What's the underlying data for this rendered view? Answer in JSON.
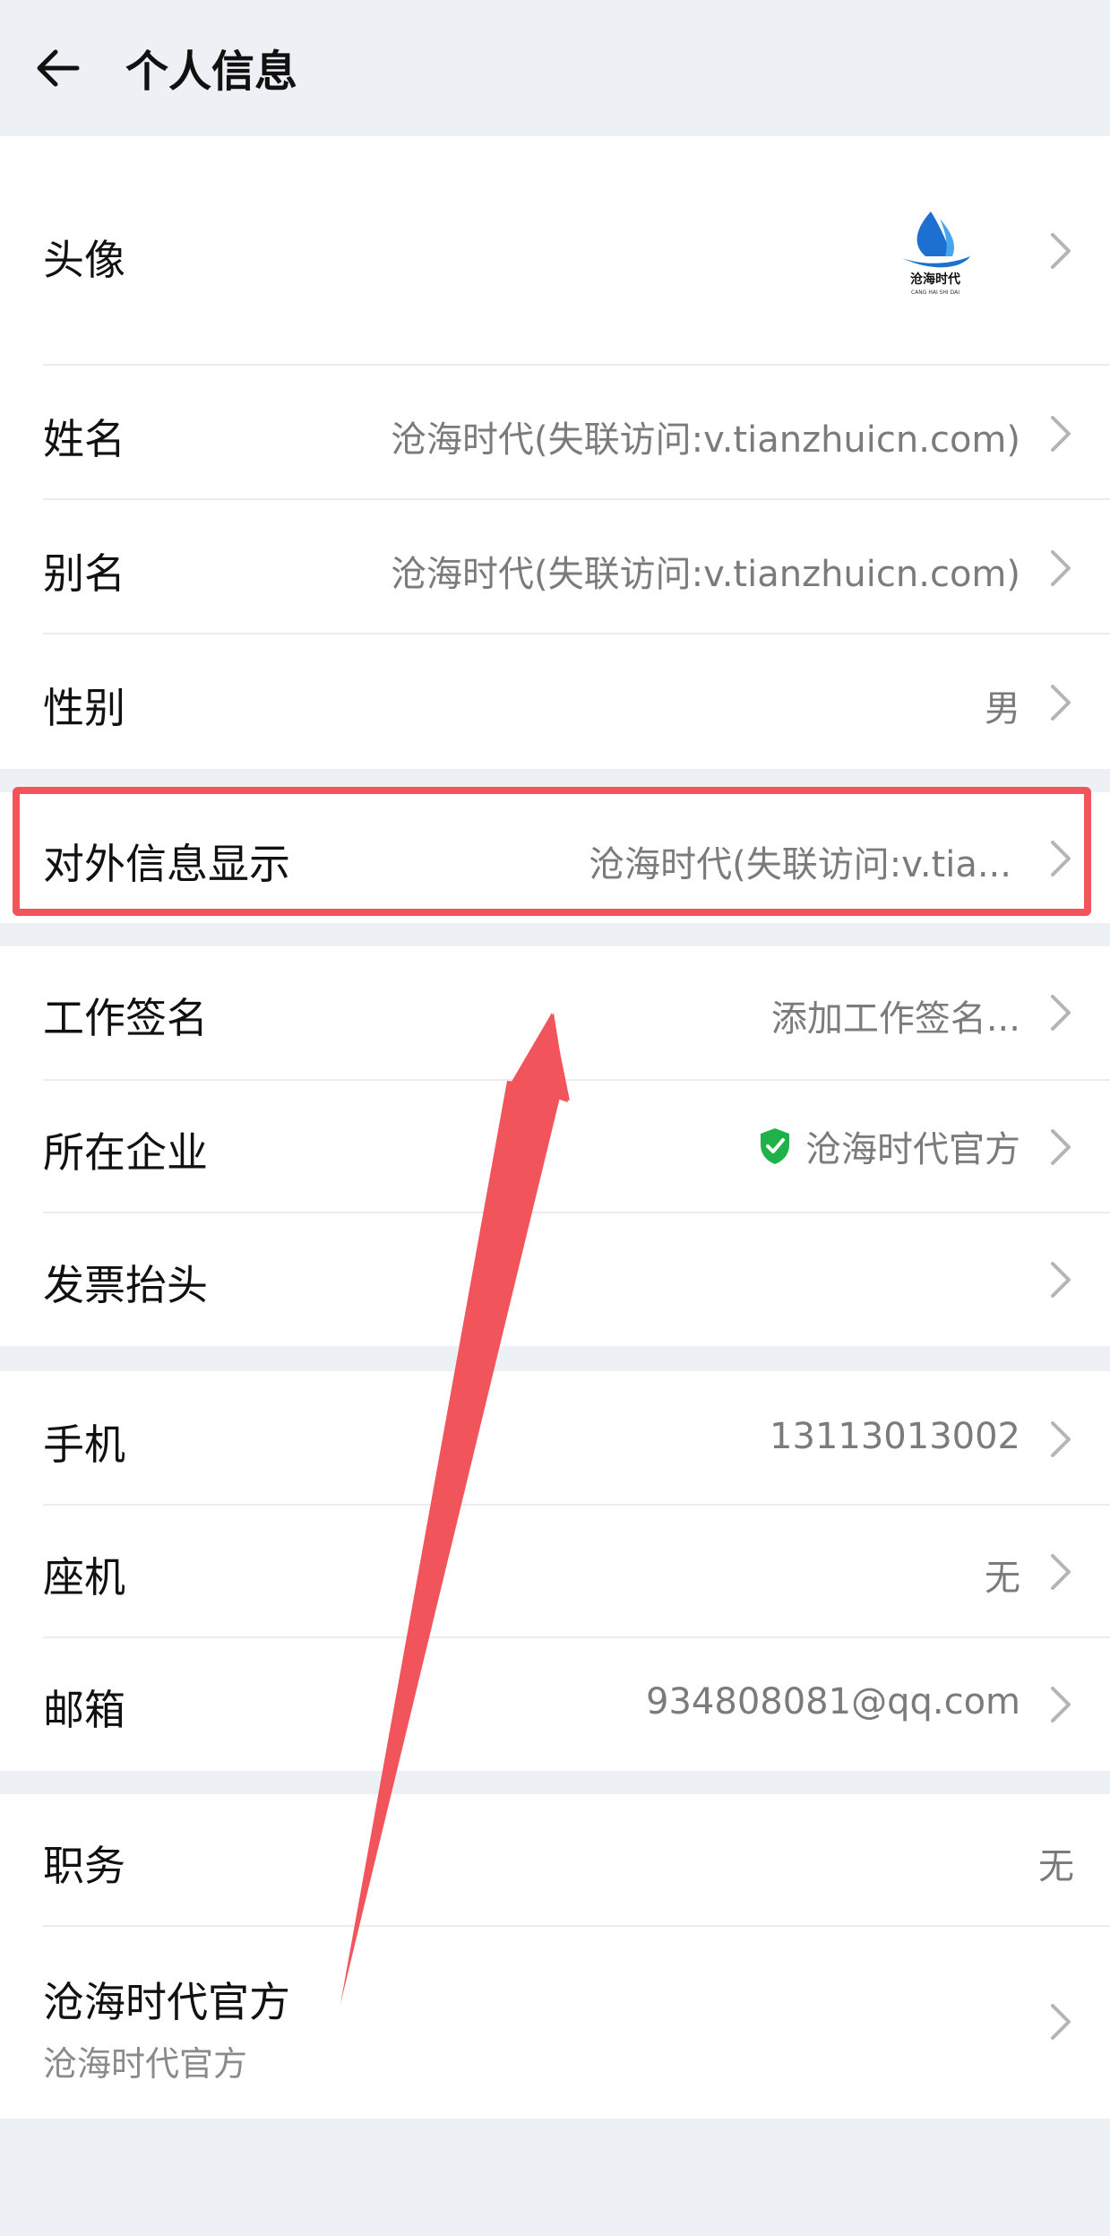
{
  "header": {
    "title": "个人信息"
  },
  "group1": {
    "avatar_label": "头像",
    "name_label": "姓名",
    "name_value": "沧海时代(失联访问:v.tianzhuicn.com)",
    "alias_label": "别名",
    "alias_value": "沧海时代(失联访问:v.tianzhuicn.com)",
    "gender_label": "性别",
    "gender_value": "男"
  },
  "group2": {
    "external_label": "对外信息显示",
    "external_value": "沧海时代(失联访问:v.tia..."
  },
  "group3": {
    "signature_label": "工作签名",
    "signature_value": "添加工作签名...",
    "company_label": "所在企业",
    "company_value": "沧海时代官方",
    "invoice_label": "发票抬头"
  },
  "group4": {
    "mobile_label": "手机",
    "mobile_value": "13113013002",
    "landline_label": "座机",
    "landline_value": "无",
    "email_label": "邮箱",
    "email_value": "934808081@qq.com"
  },
  "group5": {
    "position_label": "职务",
    "position_value": "无",
    "org_label": "沧海时代官方",
    "org_sub": "沧海时代官方"
  },
  "icons": {
    "back": "arrow-left-icon",
    "chevron": "chevron-right-icon",
    "verified": "shield-check-icon"
  },
  "colors": {
    "highlight": "#f2545b",
    "verified_green": "#1fb24a",
    "background": "#edf0f4"
  }
}
